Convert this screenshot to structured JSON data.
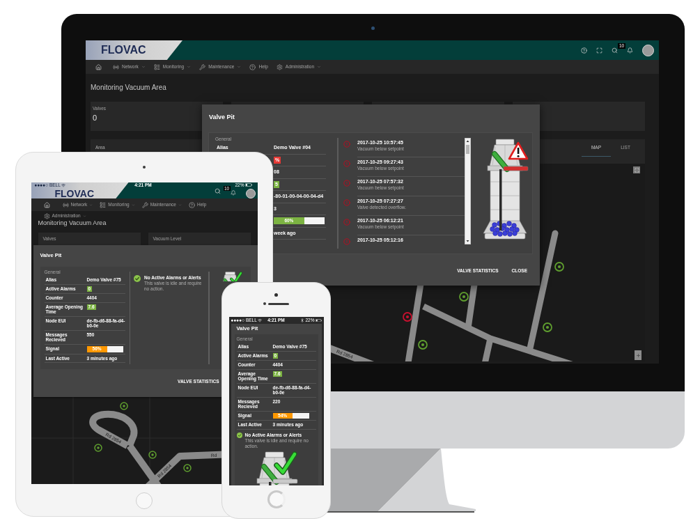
{
  "desktop": {
    "header": {
      "logo": "FLOVAC",
      "notification_count": "10"
    },
    "nav": [
      {
        "label": "Network",
        "dropdown": true
      },
      {
        "label": "Monitoring",
        "dropdown": true
      },
      {
        "label": "Maintenance",
        "dropdown": true
      },
      {
        "label": "Help",
        "dropdown": false
      },
      {
        "label": "Administration",
        "dropdown": true
      }
    ],
    "page_title": "Monitoring Vacuum Area",
    "stat_cards": [
      {
        "label": "Valves",
        "value": "0"
      }
    ],
    "area_panel": {
      "label": "Area",
      "tabs": [
        {
          "label": "MAP",
          "selected": true
        },
        {
          "label": "LIST",
          "selected": false
        }
      ]
    },
    "map": {
      "road_label": "Rd 2854",
      "markers": [
        {
          "color": "#c8102e"
        },
        {
          "color": "#5f9e2f"
        },
        {
          "color": "#5f9e2f"
        },
        {
          "color": "#5f9e2f"
        },
        {
          "color": "#5f9e2f"
        }
      ]
    },
    "modal": {
      "title": "Valve Pit",
      "alarm": true,
      "general_heading": "General",
      "general_rows": [
        {
          "kind": "text",
          "label": "Alias",
          "value": "Demo Valve #04"
        },
        {
          "kind": "badge",
          "value": "%",
          "color": "#e53935"
        },
        {
          "kind": "text",
          "value": "08"
        },
        {
          "kind": "badge",
          "value": "5",
          "color": "#7cb342"
        },
        {
          "kind": "text",
          "value": "-80-01-00-04-00-04-d4"
        },
        {
          "kind": "text",
          "value": "3"
        },
        {
          "kind": "bar",
          "value": "60%",
          "level": 0.6,
          "color": "#7cb342"
        },
        {
          "kind": "text",
          "value": "week ago"
        }
      ],
      "alarms": [
        {
          "time": "2017-10-25 10:57:45",
          "message": "Vacuum below setpoint"
        },
        {
          "time": "2017-10-25 09:27:43",
          "message": "Vacuum below setpoint"
        },
        {
          "time": "2017-10-25 07:57:32",
          "message": "Vacuum below setpoint"
        },
        {
          "time": "2017-10-25 07:27:27",
          "message": "Valve detected overflow."
        },
        {
          "time": "2017-10-25 06:12:21",
          "message": "Vacuum below setpoint"
        },
        {
          "time": "2017-10-25 05:12:16"
        }
      ],
      "buttons": [
        "VALVE STATISTICS",
        "CLOSE"
      ]
    }
  },
  "tablet": {
    "status_bar": {
      "carrier": "●●●●○ BELL",
      "time": "4:21 PM",
      "battery": "22%"
    },
    "header": {
      "logo": "FLOVAC",
      "notification_count": "10"
    },
    "nav": [
      {
        "label": "Network",
        "dropdown": true
      },
      {
        "label": "Monitoring",
        "dropdown": true
      },
      {
        "label": "Maintenance",
        "dropdown": true
      },
      {
        "label": "Help",
        "dropdown": false
      },
      {
        "label": "Administration",
        "dropdown": true
      }
    ],
    "page_title": "Monitoring Vacuum Area",
    "stat_cards": [
      {
        "label": "Valves"
      },
      {
        "label": "Vacuum Level"
      }
    ],
    "modal": {
      "title": "Valve Pit",
      "alarm": false,
      "general_heading": "General",
      "general_rows": [
        {
          "kind": "text",
          "label": "Alias",
          "value": "Demo Valve #75"
        },
        {
          "kind": "badge",
          "label": "Active Alarms",
          "value": "0",
          "color": "#7cb342"
        },
        {
          "kind": "text",
          "label": "Counter",
          "value": "4404"
        },
        {
          "kind": "badge",
          "label": "Average Opening Time",
          "value": "7.6",
          "color": "#7cb342"
        },
        {
          "kind": "text",
          "label": "Node EUI",
          "value": "de-fb-d6-88-fa-d4-b0-0e"
        },
        {
          "kind": "text",
          "label": "Messages Recieved",
          "value": "550"
        },
        {
          "kind": "bar",
          "label": "Signal",
          "value": "56%",
          "level": 0.56,
          "color": "#ff9800"
        },
        {
          "kind": "text",
          "label": "Last Active",
          "value": "3 minutes ago"
        }
      ],
      "status": {
        "title": "No Active Alarms or Alerts",
        "description": "This valve is idle and require no action."
      },
      "buttons": [
        "VALVE STATISTICS"
      ]
    },
    "map": {
      "road_labels": [
        "Rd 2854",
        "Rd 2854",
        "Rd"
      ],
      "markers": [
        {
          "color": "#5f9e2f"
        },
        {
          "color": "#5f9e2f"
        },
        {
          "color": "#5f9e2f"
        },
        {
          "color": "#5f9e2f"
        }
      ]
    }
  },
  "phone": {
    "status_bar": {
      "carrier": "●●●●○ BELL",
      "time": "4:21 PM",
      "battery": "22%"
    },
    "modal": {
      "title": "Valve Pit",
      "alarm": false,
      "general_heading": "General",
      "general_rows": [
        {
          "kind": "text",
          "label": "Alias",
          "value": "Demo Valve #75"
        },
        {
          "kind": "badge",
          "label": "Active Alarms",
          "value": "0",
          "color": "#7cb342"
        },
        {
          "kind": "text",
          "label": "Counter",
          "value": "4404"
        },
        {
          "kind": "badge",
          "label": "Average Opening Time",
          "value": "7.6",
          "color": "#7cb342"
        },
        {
          "kind": "text",
          "label": "Node EUI",
          "value": "de-fb-d6-88-fa-d4-b0-0e"
        },
        {
          "kind": "text",
          "label": "Messages Recieved",
          "value": "220"
        },
        {
          "kind": "bar",
          "label": "Signal",
          "value": "54%",
          "level": 0.54,
          "color": "#ff9800"
        },
        {
          "kind": "text",
          "label": "Last Active",
          "value": "3 minutes ago"
        }
      ],
      "status": {
        "title": "No Active Alarms or Alerts",
        "description": "This valve is idle and require no action."
      }
    }
  }
}
